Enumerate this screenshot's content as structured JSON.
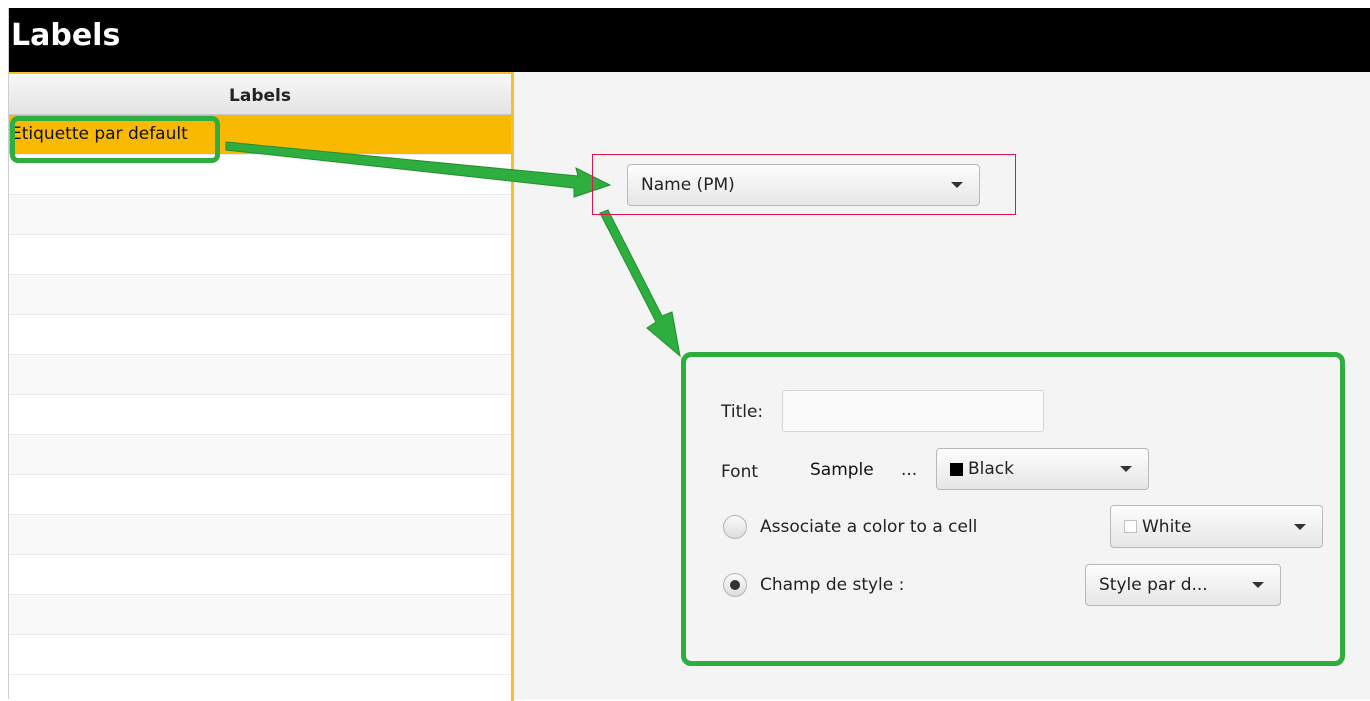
{
  "window": {
    "title": "Labels"
  },
  "labels_list": {
    "header": "Labels",
    "items": [
      "Etiquette par default",
      "",
      "",
      "",
      "",
      "",
      "",
      "",
      "",
      "",
      "",
      "",
      "",
      ""
    ]
  },
  "label_field_combo": {
    "value": "Name (PM)"
  },
  "settings": {
    "title_label": "Title:",
    "title_value": "",
    "font_label": "Font",
    "font_sample": "Sample",
    "font_button": "...",
    "font_color": {
      "label": "Black",
      "swatch": "#000000"
    },
    "associate_radio": {
      "label": "Associate a color to a cell",
      "selected": false
    },
    "cell_color": {
      "label": "White",
      "swatch": "#ffffff"
    },
    "style_radio": {
      "label": "Champ de style :",
      "selected": true
    },
    "style_combo": {
      "value": "Style par d..."
    }
  },
  "colors": {
    "selection": "#f8b900",
    "highlight": "#2eae3e",
    "focus_border": "#e0144c",
    "titlebar": "#000000"
  }
}
